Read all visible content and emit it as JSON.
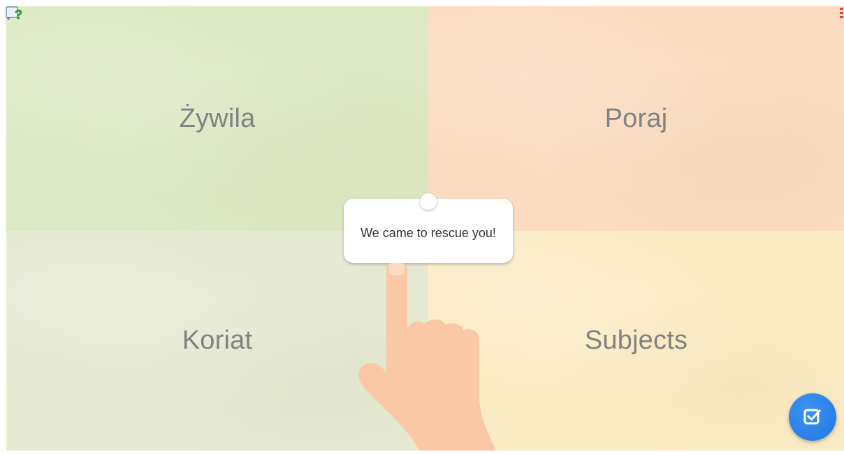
{
  "quadrants": {
    "top_left": {
      "label": "Żywila",
      "color": "#dde9c4"
    },
    "top_right": {
      "label": "Poraj",
      "color": "#fbdcc0"
    },
    "bottom_left": {
      "label": "Koriat",
      "color": "#e6ead3"
    },
    "bottom_right": {
      "label": "Subjects",
      "color": "#fcecc5"
    }
  },
  "tutorial": {
    "bubble_text": "We came to rescue you!"
  },
  "colors": {
    "hand": "#fbc8a6",
    "check_button": "#2a7ee6"
  },
  "icons": {
    "help": "help-icon",
    "check": "checkbox-check-icon",
    "corner": "corner-marker-icon"
  }
}
